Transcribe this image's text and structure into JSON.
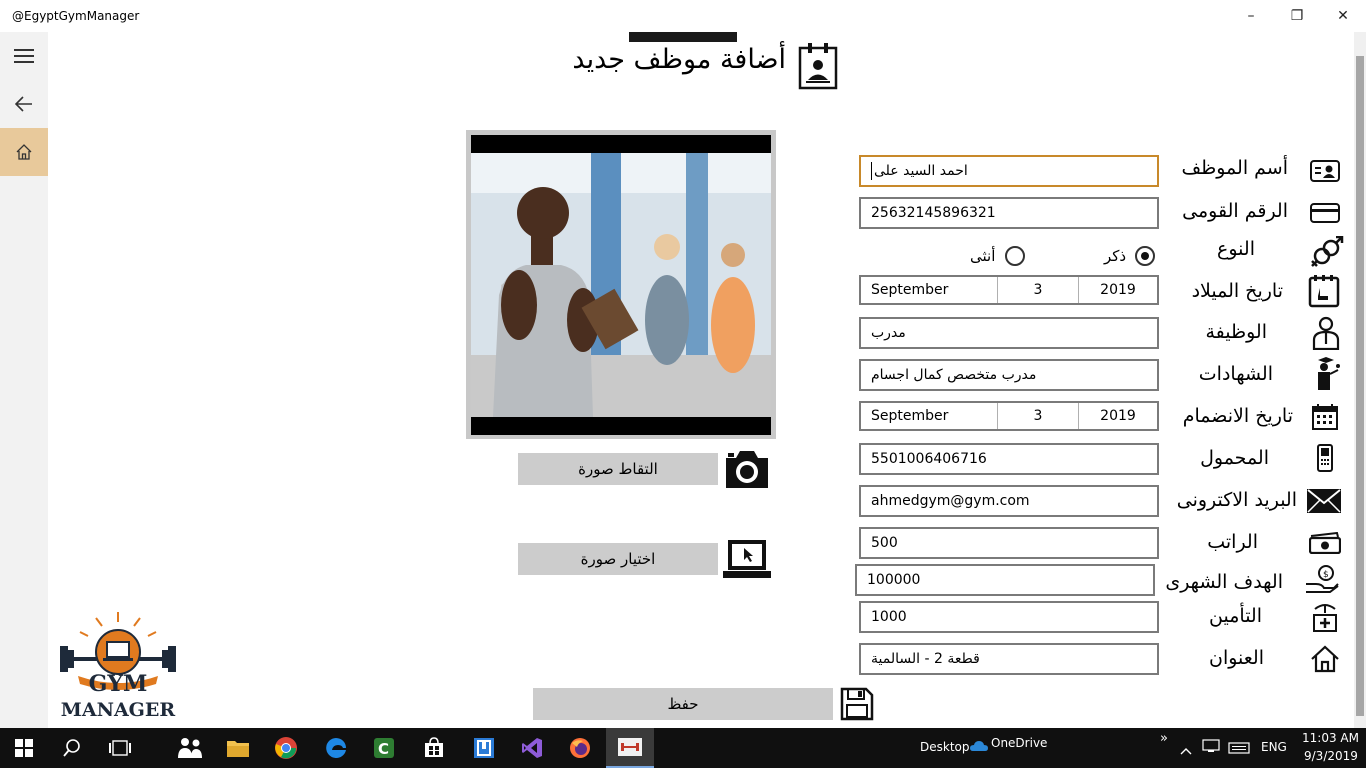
{
  "window": {
    "title": "@EgyptGymManager",
    "minimize": "–",
    "maximize": "❐",
    "close": "✕"
  },
  "nav": {
    "menu_icon": "hamburger-icon",
    "back_icon": "back-arrow-icon",
    "home_icon": "home-icon"
  },
  "page": {
    "title": "أضافة موظف جديد"
  },
  "form": {
    "name": {
      "label": "أسم الموظف",
      "value": "احمد السيد على"
    },
    "national_id": {
      "label": "الرقم القومى",
      "value": "25632145896321"
    },
    "gender": {
      "label": "النوع",
      "male": "ذكر",
      "female": "أنثى",
      "selected": "male"
    },
    "birth_date": {
      "label": "تاريخ الميلاد",
      "month": "September",
      "day": "3",
      "year": "2019"
    },
    "job": {
      "label": "الوظيفة",
      "value": "مدرب"
    },
    "certificates": {
      "label": "الشهادات",
      "value": "مدرب متخصص كمال اجسام"
    },
    "join_date": {
      "label": "تاريخ الانضمام",
      "month": "September",
      "day": "3",
      "year": "2019"
    },
    "mobile": {
      "label": "المحمول",
      "value": "5501006406716"
    },
    "email": {
      "label": "البريد الاكترونى",
      "value": "ahmedgym@gym.com"
    },
    "salary": {
      "label": "الراتب",
      "value": "500"
    },
    "monthly_target": {
      "label": "الهدف الشهرى",
      "value": "100000"
    },
    "insurance": {
      "label": "التأمين",
      "value": "1000"
    },
    "address": {
      "label": "العنوان",
      "value": "قطعة 2 - السالمية"
    }
  },
  "photo": {
    "capture_label": "التقاط صورة",
    "choose_label": "اختيار صورة"
  },
  "actions": {
    "save_label": "حفظ"
  },
  "logo": {
    "line1": "GYM",
    "line2": "MANAGER"
  },
  "colors": {
    "accent": "#c8892a",
    "rail_home": "#e8c99b",
    "logo_orange": "#e07a1f",
    "logo_dark": "#1e2a3a"
  },
  "taskbar": {
    "desktop": "Desktop",
    "onedrive": "OneDrive",
    "lang": "ENG",
    "time": "11:03 AM",
    "date": "9/3/2019",
    "chevron": "»"
  }
}
